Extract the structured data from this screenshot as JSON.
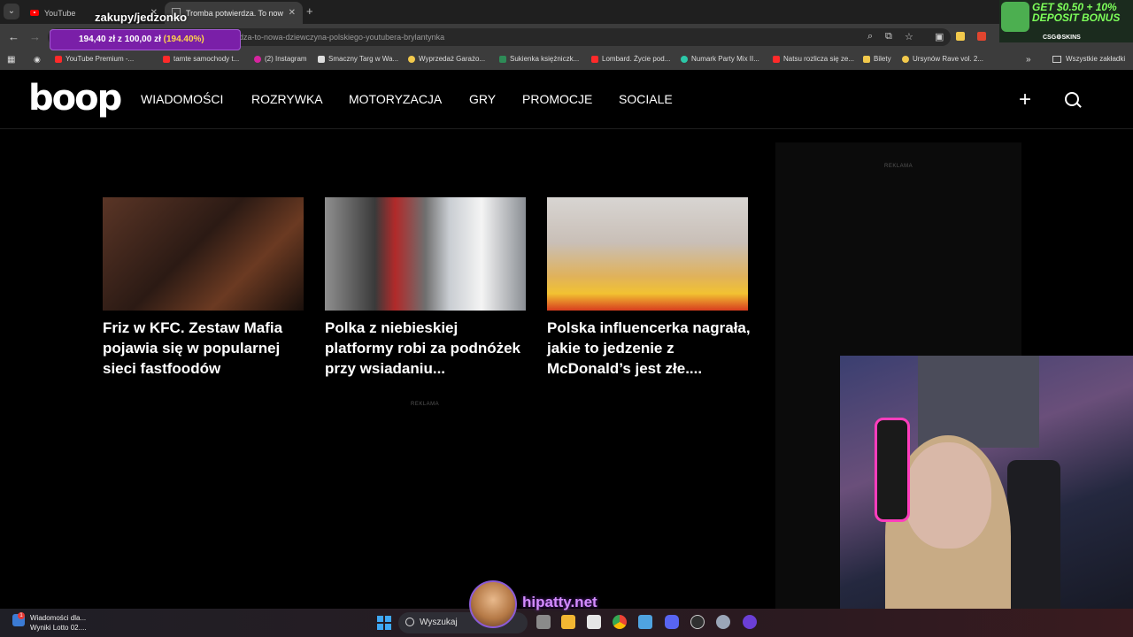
{
  "browser": {
    "tabs": [
      {
        "title": "YouTube",
        "active": false
      },
      {
        "title": "Tromba potwierdza. To nowa d...",
        "active": true
      }
    ],
    "url": "dza-to-nowa-dziewczyna-polskiego-youtubera-brylantynka",
    "bookmarks": [
      "YouTube Premium -...",
      "tamte samochody t...",
      "(2) Instagram",
      "Smaczny Targ w Wa...",
      "Wyprzedaż Garażo...",
      "Sukienka księżniczk...",
      "Lombard. Życie pod...",
      "Numark Party Mix II...",
      "Natsu rozlicza się ze...",
      "Bilety",
      "Ursynów Rave vol. 2..."
    ],
    "all_bookmarks": "Wszystkie zakładki"
  },
  "overlay": {
    "title": "zakupy/jedzonko",
    "progress_text": "194,40 zł z 100,00 zł",
    "progress_pct": "(194.40%)",
    "progress_value": 1.944,
    "watermark": "hipatty.net"
  },
  "promo": {
    "line1": "GET $0.50 + 10%",
    "line2": "DEPOSIT BONUS",
    "brand": "CSG⚙SKINS"
  },
  "site": {
    "logo": "boop",
    "nav": [
      "WIADOMOŚCI",
      "ROZRYWKA",
      "MOTORYZACJA",
      "GRY",
      "PROMOCJE",
      "SOCIALE"
    ],
    "ad_label": "REKLAMA",
    "articles": [
      {
        "title": "Friz w KFC. Zestaw Mafia pojawia się w popularnej sieci fastfoodów"
      },
      {
        "title": "Polka z niebieskiej platformy robi za podnóżek przy wsiadaniu..."
      },
      {
        "title": "Polska influencerka nagrała, jakie to jedzenie z McDonald’s jest złe...."
      }
    ]
  },
  "taskbar": {
    "news_line1": "Wiadomości dla...",
    "news_line2": "Wyniki Lotto 02....",
    "news_badge": "1",
    "search_placeholder": "Wyszukaj"
  }
}
